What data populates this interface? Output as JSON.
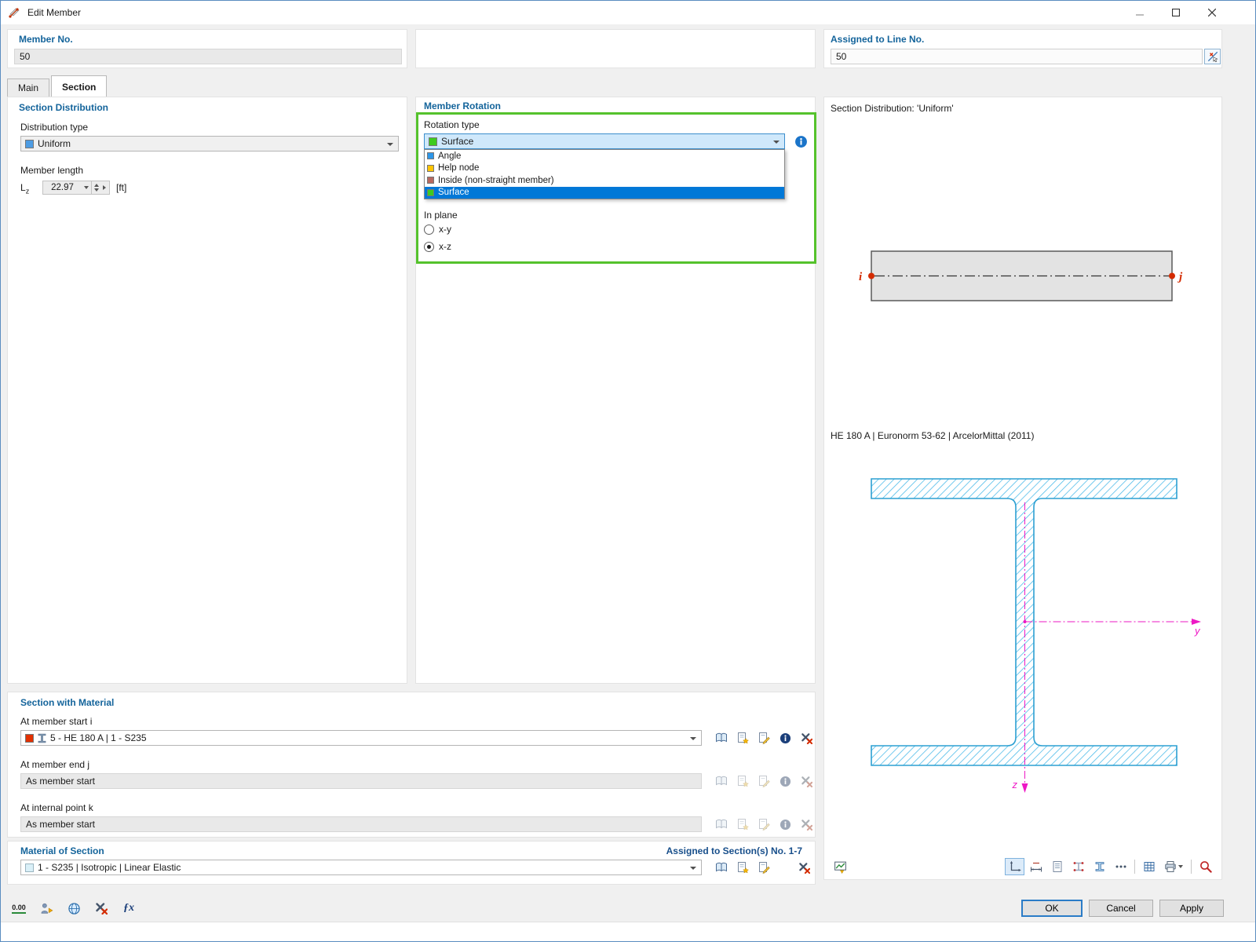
{
  "window": {
    "title": "Edit Member"
  },
  "header": {
    "member_no": {
      "label": "Member No.",
      "value": "50"
    },
    "assigned_to_line": {
      "label": "Assigned to Line No.",
      "value": "50"
    }
  },
  "tabs": [
    {
      "label": "Main",
      "active": false
    },
    {
      "label": "Section",
      "active": true
    }
  ],
  "section_distribution": {
    "heading": "Section Distribution",
    "distribution_type_label": "Distribution type",
    "distribution_type_value": "Uniform",
    "distribution_swatch_color": "#4d9ce3",
    "member_length_label": "Member length",
    "length_symbol": "L",
    "length_symbol_sub": "z",
    "length_value": "22.97",
    "length_unit": "[ft]"
  },
  "member_rotation": {
    "heading": "Member Rotation",
    "rotation_type_label": "Rotation type",
    "selected_value": "Surface",
    "selected_swatch_color": "#3ecb1e",
    "options": [
      {
        "label": "Angle",
        "swatch_color": "#2d96e8"
      },
      {
        "label": "Help node",
        "swatch_color": "#ffc400"
      },
      {
        "label": "Inside (non-straight member)",
        "swatch_color": "#b8685f"
      },
      {
        "label": "Surface",
        "swatch_color": "#3ecb1e",
        "selected": true
      }
    ],
    "in_plane_label": "In plane",
    "plane_xy_label": "x-y",
    "plane_xz_label": "x-z",
    "selected_plane": "x-z"
  },
  "preview": {
    "distribution_caption": "Section Distribution: 'Uniform'",
    "node_start_label": "i",
    "node_end_label": "j",
    "section_caption": "HE 180 A | Euronorm 53-62 | ArcelorMittal (2011)",
    "axis_y_label": "y",
    "axis_z_label": "z"
  },
  "section_with_material": {
    "heading": "Section with Material",
    "start_label": "At member start i",
    "start_value": "5 - HE 180 A | 1 - S235",
    "start_swatch_color": "#e23000",
    "end_label": "At member end j",
    "end_value": "As member start",
    "internal_label": "At internal point k",
    "internal_value": "As member start"
  },
  "material_of_section": {
    "heading": "Material of Section",
    "assigned_note": "Assigned to Section(s) No. 1-7",
    "value": "1 - S235 | Isotropic | Linear Elastic",
    "swatch_color": "#daf0f8"
  },
  "footer": {
    "decimal_button_label": "0.00",
    "fx_button_label": "ƒx",
    "ok_label": "OK",
    "cancel_label": "Cancel",
    "apply_label": "Apply"
  },
  "colors": {
    "heading_blue": "#14649b",
    "highlight_green": "#55c22c",
    "selection_blue": "#0078d7",
    "node_red": "#d42b00",
    "axis_magenta": "#ee18c5",
    "section_hatch_blue": "#3bb0e4"
  }
}
